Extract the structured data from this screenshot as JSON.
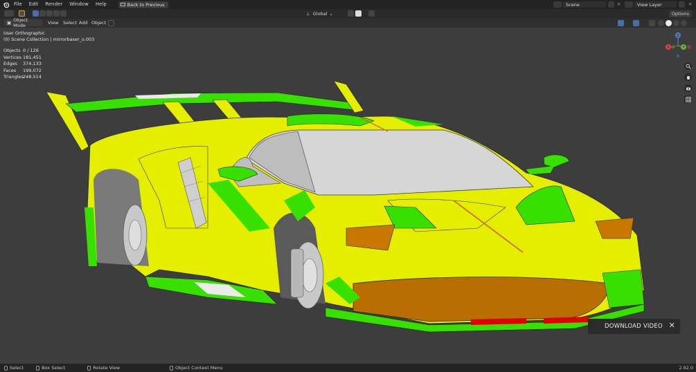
{
  "menu": {
    "items": [
      "File",
      "Edit",
      "Render",
      "Window",
      "Help"
    ],
    "back_button": "Back to Previous",
    "scene": "Scene",
    "view_layer": "View Layer"
  },
  "header": {
    "transform_orientation": "Global",
    "mode": "Object Mode",
    "view_menu": [
      "View",
      "Select",
      "Add",
      "Object"
    ],
    "options": "Options"
  },
  "viewport": {
    "view_name": "User Orthographic",
    "collection": "(0) Scene Collection | mirrorbaser_o.003",
    "stats": [
      {
        "label": "Objects",
        "value": "0 / 126"
      },
      {
        "label": "Vertices",
        "value": "181,451"
      },
      {
        "label": "Edges",
        "value": "374,133"
      },
      {
        "label": "Faces",
        "value": "199,072"
      },
      {
        "label": "Triangles",
        "value": "248,514"
      }
    ],
    "gizmo": {
      "x": "X",
      "y": "Y",
      "z": "Z"
    },
    "colors": {
      "car_body": "#e8f000",
      "car_accent": "#35e000",
      "amber": "#c87800",
      "background": "#3d3d3d"
    }
  },
  "download": {
    "label": "DOWNLOAD VIDEO",
    "close": "✕"
  },
  "statusbar": {
    "items": [
      "Select",
      "Box Select",
      "Rotate View",
      "Object Context Menu"
    ],
    "version": "2.92.0"
  }
}
